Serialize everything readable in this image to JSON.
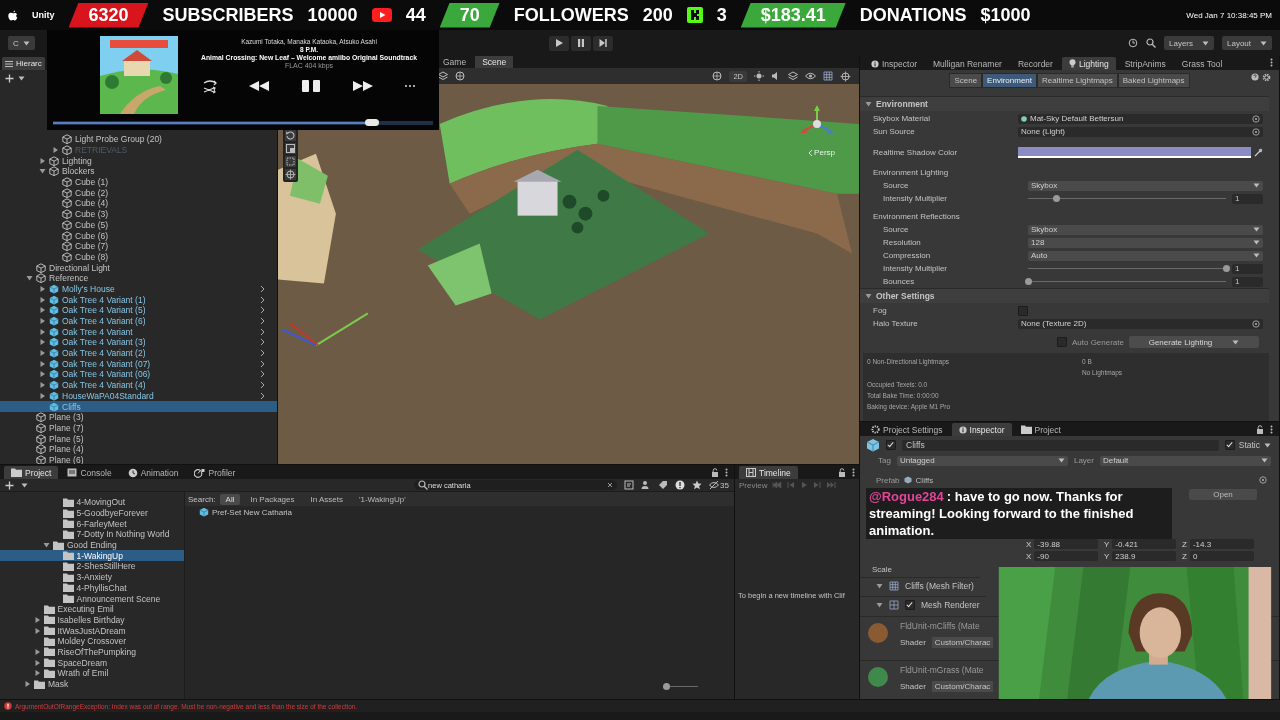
{
  "menu_bar": {
    "app": "Unity",
    "clock": "Wed Jan 7  10:38:45 PM"
  },
  "stream_goals": [
    {
      "count": "6320",
      "label": "SUBSCRIBERS",
      "goal": "10000",
      "kind": "youtube",
      "platform_count": "44",
      "color": "#d8141c"
    },
    {
      "count": "70",
      "label": "FOLLOWERS",
      "goal": "200",
      "kind": "kick",
      "platform_count": "3",
      "color": "#3aa83a"
    },
    {
      "count": "$183.41",
      "label": "DONATIONS",
      "goal": "$1000",
      "color": "#3aa83a"
    }
  ],
  "toolbar": {
    "account": "C",
    "play_controls": [
      {
        "kind": "play"
      },
      {
        "kind": "pause"
      },
      {
        "kind": "step"
      }
    ],
    "layers": "Layers",
    "layout": "Layout"
  },
  "music_player": {
    "artist": "Kazumi Totaka, Manaka Kataoka, Atsuko Asahi",
    "title": "8 P.M.",
    "album": "Animal Crossing: New Leaf – Welcome amiibo Original Soundtrack",
    "format": "FLAC 404 kbps",
    "playing": true,
    "level": 0.84
  },
  "hierarchy": {
    "tab": "Hierarc",
    "items": [
      {
        "children": [
          {
            "children": [
              {
                "label": "Light Probe Group (20)",
                "kind": "object",
                "selected": false
              },
              {
                "label": "RETRIEVALS",
                "kind": "object",
                "expanded": false,
                "disabled": true,
                "selected": false
              }
            ]
          },
          {
            "label": "Lighting",
            "kind": "object",
            "expanded": false,
            "selected": false
          },
          {
            "label": "Blockers",
            "kind": "object",
            "expanded": true,
            "selected": false,
            "children": [
              {
                "label": "Cube (1)",
                "kind": "object",
                "selected": false
              },
              {
                "label": "Cube (2)",
                "kind": "object",
                "selected": false
              },
              {
                "label": "Cube (4)",
                "kind": "object",
                "selected": false
              },
              {
                "label": "Cube (3)",
                "kind": "object",
                "selected": false
              },
              {
                "label": "Cube (5)",
                "kind": "object",
                "selected": false
              },
              {
                "label": "Cube (6)",
                "kind": "object",
                "selected": false
              },
              {
                "label": "Cube (7)",
                "kind": "object",
                "selected": false
              },
              {
                "label": "Cube (8)",
                "kind": "object",
                "selected": false
              }
            ]
          }
        ]
      },
      {
        "label": "Directional Light",
        "kind": "object",
        "selected": false
      },
      {
        "label": "Reference",
        "kind": "object",
        "expanded": true,
        "selected": false,
        "children": [
          {
            "label": "Molly's House",
            "kind": "prefab",
            "expanded": false,
            "selected": false
          },
          {
            "label": "Oak Tree 4 Variant (1)",
            "kind": "prefab",
            "expanded": false,
            "selected": false
          },
          {
            "label": "Oak Tree 4 Variant (5)",
            "kind": "prefab",
            "expanded": false,
            "selected": false
          },
          {
            "label": "Oak Tree 4 Variant (6)",
            "kind": "prefab",
            "expanded": false,
            "selected": false
          },
          {
            "label": "Oak Tree 4 Variant",
            "kind": "prefab",
            "expanded": false,
            "selected": false
          },
          {
            "label": "Oak Tree 4 Variant (3)",
            "kind": "prefab",
            "expanded": false,
            "selected": false
          },
          {
            "label": "Oak Tree 4 Variant (2)",
            "kind": "prefab",
            "expanded": false,
            "selected": false
          },
          {
            "label": "Oak Tree 4 Variant (07)",
            "kind": "prefab",
            "expanded": false,
            "selected": false
          },
          {
            "label": "Oak Tree 4 Variant (06)",
            "kind": "prefab",
            "expanded": false,
            "selected": false
          },
          {
            "label": "Oak Tree 4 Variant (4)",
            "kind": "prefab",
            "expanded": false,
            "selected": false
          },
          {
            "label": "HouseWaPA04Standard",
            "kind": "prefab",
            "expanded": false,
            "selected": false
          },
          {
            "label": "Cliffs",
            "kind": "prefab",
            "selected": true
          }
        ]
      },
      {
        "label": "Plane (3)",
        "kind": "object",
        "selected": false
      },
      {
        "label": "Plane (7)",
        "kind": "object",
        "selected": false
      },
      {
        "label": "Plane (5)",
        "kind": "object",
        "selected": false
      },
      {
        "label": "Plane (4)",
        "kind": "object",
        "selected": false
      },
      {
        "label": "Plane (6)",
        "kind": "object",
        "selected": false
      }
    ]
  },
  "scene_view": {
    "tabs": [
      {
        "label": "Game",
        "selected": false
      },
      {
        "label": "Scene",
        "selected": true
      }
    ],
    "mode_2d": "2D",
    "camera": "Persp",
    "kind": "picture"
  },
  "lighting_window": {
    "tabs": [
      {
        "label": "Inspector",
        "selected": false
      },
      {
        "label": "Mulligan Renamer",
        "selected": false
      },
      {
        "label": "Recorder",
        "selected": false
      },
      {
        "label": "Lighting",
        "selected": true
      },
      {
        "label": "StripAnims",
        "selected": false
      },
      {
        "label": "Grass Tool",
        "selected": false
      }
    ],
    "subtabs": [
      {
        "label": "Scene",
        "selected": false
      },
      {
        "label": "Environment",
        "selected": true
      },
      {
        "label": "Realtime Lightmaps",
        "selected": false
      },
      {
        "label": "Baked Lightmaps",
        "selected": false
      }
    ],
    "sections": [
      {
        "title": "Environment",
        "expanded": true,
        "rows": [
          {
            "kind": "material",
            "label": "Skybox Material",
            "value": "Mat-Sky Default Bettersun"
          },
          {
            "kind": "object",
            "label": "Sun Source",
            "value": "None (Light)"
          },
          {
            "kind": "color",
            "label": "Realtime Shadow Color",
            "color": "#8c8cc4"
          },
          {
            "kind": "group",
            "label": "Environment Lighting",
            "children": [
              {
                "kind": "dropdown",
                "label": "Source",
                "value": "Skybox"
              },
              {
                "kind": "slider",
                "label": "Intensity Multiplier",
                "level": 0.14,
                "reading": "1"
              }
            ]
          },
          {
            "kind": "group",
            "label": "Environment Reflections",
            "children": [
              {
                "kind": "dropdown",
                "label": "Source",
                "value": "Skybox"
              },
              {
                "kind": "dropdown",
                "label": "Resolution",
                "value": "128"
              },
              {
                "kind": "dropdown",
                "label": "Compression",
                "value": "Auto"
              },
              {
                "kind": "slider",
                "label": "Intensity Multiplier",
                "level": 1,
                "reading": "1"
              },
              {
                "kind": "slider",
                "label": "Bounces",
                "level": 0,
                "reading": "1"
              }
            ]
          }
        ]
      },
      {
        "title": "Other Settings",
        "expanded": true,
        "rows": [
          {
            "kind": "checkbox",
            "label": "Fog",
            "checked": false
          },
          {
            "kind": "object",
            "label": "Halo Texture",
            "value": "None (Texture 2D)"
          }
        ]
      }
    ],
    "auto_generate": {
      "label": "Auto Generate",
      "checked": false
    },
    "generate_button": "Generate Lighting",
    "stats_left": [
      "0 Non-Directional Lightmaps",
      "Occupied Texels: 0.0",
      "Total Bake Time: 0:00:00",
      "Baking device: Apple M1 Pro"
    ],
    "stats_right": [
      "0 B",
      "No Lightmaps"
    ]
  },
  "inspector": {
    "tabs": [
      {
        "label": "Project Settings",
        "selected": false
      },
      {
        "label": "Inspector",
        "selected": true
      },
      {
        "label": "Project",
        "selected": false
      }
    ],
    "object": {
      "name": "Cliffs",
      "active": true,
      "static_label": "Static",
      "static": true,
      "tag_label": "Tag",
      "tag": "Untagged",
      "layer_label": "Layer",
      "layer": "Default",
      "prefab_label": "Prefab",
      "prefab": "Cliffs",
      "open_button": "Open"
    },
    "transform": [
      {
        "fields": [
          {
            "axis": "X",
            "value": "-39.88"
          },
          {
            "axis": "Y",
            "value": "-0.421"
          },
          {
            "axis": "Z",
            "value": "-14.3"
          }
        ]
      },
      {
        "fields": [
          {
            "axis": "X",
            "value": "-90"
          },
          {
            "axis": "Y",
            "value": "238.9"
          },
          {
            "axis": "Z",
            "value": "0"
          }
        ]
      }
    ],
    "scale_label": "Scale",
    "components": [
      {
        "kind": "mesh_filter",
        "label": "Cliffs (Mesh Filter)"
      },
      {
        "kind": "mesh_renderer",
        "label": "Mesh Renderer",
        "enabled": true
      }
    ],
    "materials": [
      {
        "name": "FldUnit-mCliffs (Mate",
        "shader_label": "Shader",
        "shader": "Custom/Charac",
        "color": "#8a5a33"
      },
      {
        "name": "FldUnit-mGrass (Mate",
        "shader_label": "Shader",
        "shader": "Custom/Charac",
        "color": "#3f8a4a"
      }
    ]
  },
  "chat": {
    "user": "@Rogue284",
    "message": ": have to go now. Thanks for streaming! Looking forward to the finished animation."
  },
  "project": {
    "tabs": [
      {
        "label": "Project",
        "selected": true
      },
      {
        "label": "Console",
        "selected": false
      },
      {
        "label": "Animation",
        "selected": false
      },
      {
        "label": "Profiler",
        "selected": false
      }
    ],
    "tree": [
      {
        "children": [
          {
            "children": [
              {
                "children": [
                  {
                    "label": "4-MovingOut",
                    "selected": false
                  },
                  {
                    "label": "5-GoodbyeForever",
                    "selected": false
                  },
                  {
                    "label": "6-FarleyMeet",
                    "selected": false
                  },
                  {
                    "label": "7-Dotty In Nothing World",
                    "selected": false
                  }
                ]
              },
              {
                "label": "Good Ending",
                "expanded": true,
                "selected": false,
                "children": [
                  {
                    "label": "1-WakingUp",
                    "selected": true
                  },
                  {
                    "label": "2-ShesStillHere",
                    "selected": false
                  },
                  {
                    "label": "3-Anxiety",
                    "selected": false
                  },
                  {
                    "label": "4-PhyllisChat",
                    "selected": false
                  },
                  {
                    "label": "Announcement Scene",
                    "selected": false
                  }
                ]
              }
            ]
          },
          {
            "label": "Executing Emil",
            "selected": false
          },
          {
            "label": "Isabelles Birthday",
            "expanded": false,
            "selected": false
          },
          {
            "label": "ItWasJustADream",
            "expanded": false,
            "selected": false
          },
          {
            "label": "Moldey Crossover",
            "selected": false
          },
          {
            "label": "RiseOfThePumpking",
            "expanded": false,
            "selected": false
          },
          {
            "label": "SpaceDream",
            "expanded": false,
            "selected": false
          },
          {
            "label": "Wrath of Emil",
            "expanded": false,
            "selected": false
          }
        ]
      },
      {
        "label": "Mask",
        "expanded": false,
        "selected": false
      }
    ],
    "search": {
      "value": "new catharia"
    },
    "filter_label": "Search:",
    "filters": [
      {
        "label": "All",
        "selected": true
      },
      {
        "label": "In Packages",
        "selected": false
      },
      {
        "label": "In Assets",
        "selected": false
      },
      {
        "label": "'1-WakingUp'",
        "selected": false
      }
    ],
    "results": [
      {
        "label": "Pref-Set New Catharia"
      }
    ],
    "hidden_count": "35",
    "zoom_slider": {
      "level": 0
    }
  },
  "timeline": {
    "tab": "Timeline",
    "preview": "Preview",
    "message": "To begin a new timeline with Clif"
  },
  "status_bar": {
    "message": "ArgumentOutOfRangeException: Index was out of range. Must be non-negative and less than the size of the collection."
  }
}
